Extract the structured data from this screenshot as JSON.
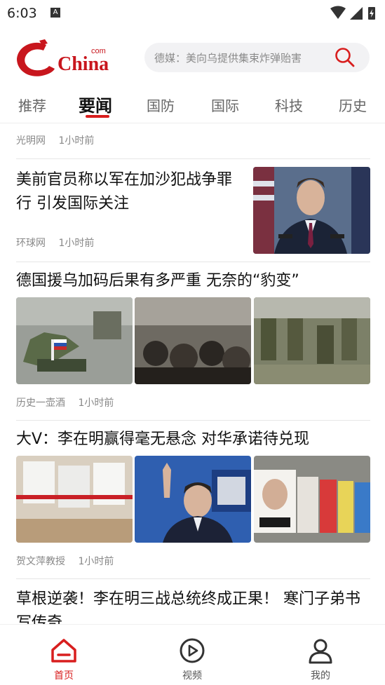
{
  "status": {
    "time": "6:03",
    "notif_letter": "A"
  },
  "header": {
    "logo_text": "China",
    "logo_com": "com",
    "search_placeholder": "德媒：美向乌提供集束炸弹贻害"
  },
  "tabs": [
    {
      "label": "推荐",
      "active": false
    },
    {
      "label": "要闻",
      "active": true
    },
    {
      "label": "国防",
      "active": false
    },
    {
      "label": "国际",
      "active": false
    },
    {
      "label": "科技",
      "active": false
    },
    {
      "label": "历史",
      "active": false
    }
  ],
  "feed": [
    {
      "title": "",
      "source": "光明网",
      "time": "1小时前"
    },
    {
      "title": "美前官员称以军在加沙犯战争罪行 引发国际关注",
      "source": "环球网",
      "time": "1小时前",
      "thumb": "press-briefing-photo"
    },
    {
      "title": "德国援乌加码后果有多严重 无奈的“豹变”",
      "source": "历史一壶酒",
      "time": "1小时前"
    },
    {
      "title": "大V：李在明赢得毫无悬念 对华承诺待兑现",
      "source": "贺文萍教授",
      "time": "1小时前"
    },
    {
      "title": "草根逆袭！李在明三战总统终成正果！ 寒门子弟书写传奇"
    }
  ],
  "bottom_nav": [
    {
      "label": "首页",
      "icon": "home-icon",
      "active": true
    },
    {
      "label": "视频",
      "icon": "play-icon",
      "active": false
    },
    {
      "label": "我的",
      "icon": "user-icon",
      "active": false
    }
  ],
  "colors": {
    "accent": "#d81e1e",
    "meta_text": "#888888"
  }
}
